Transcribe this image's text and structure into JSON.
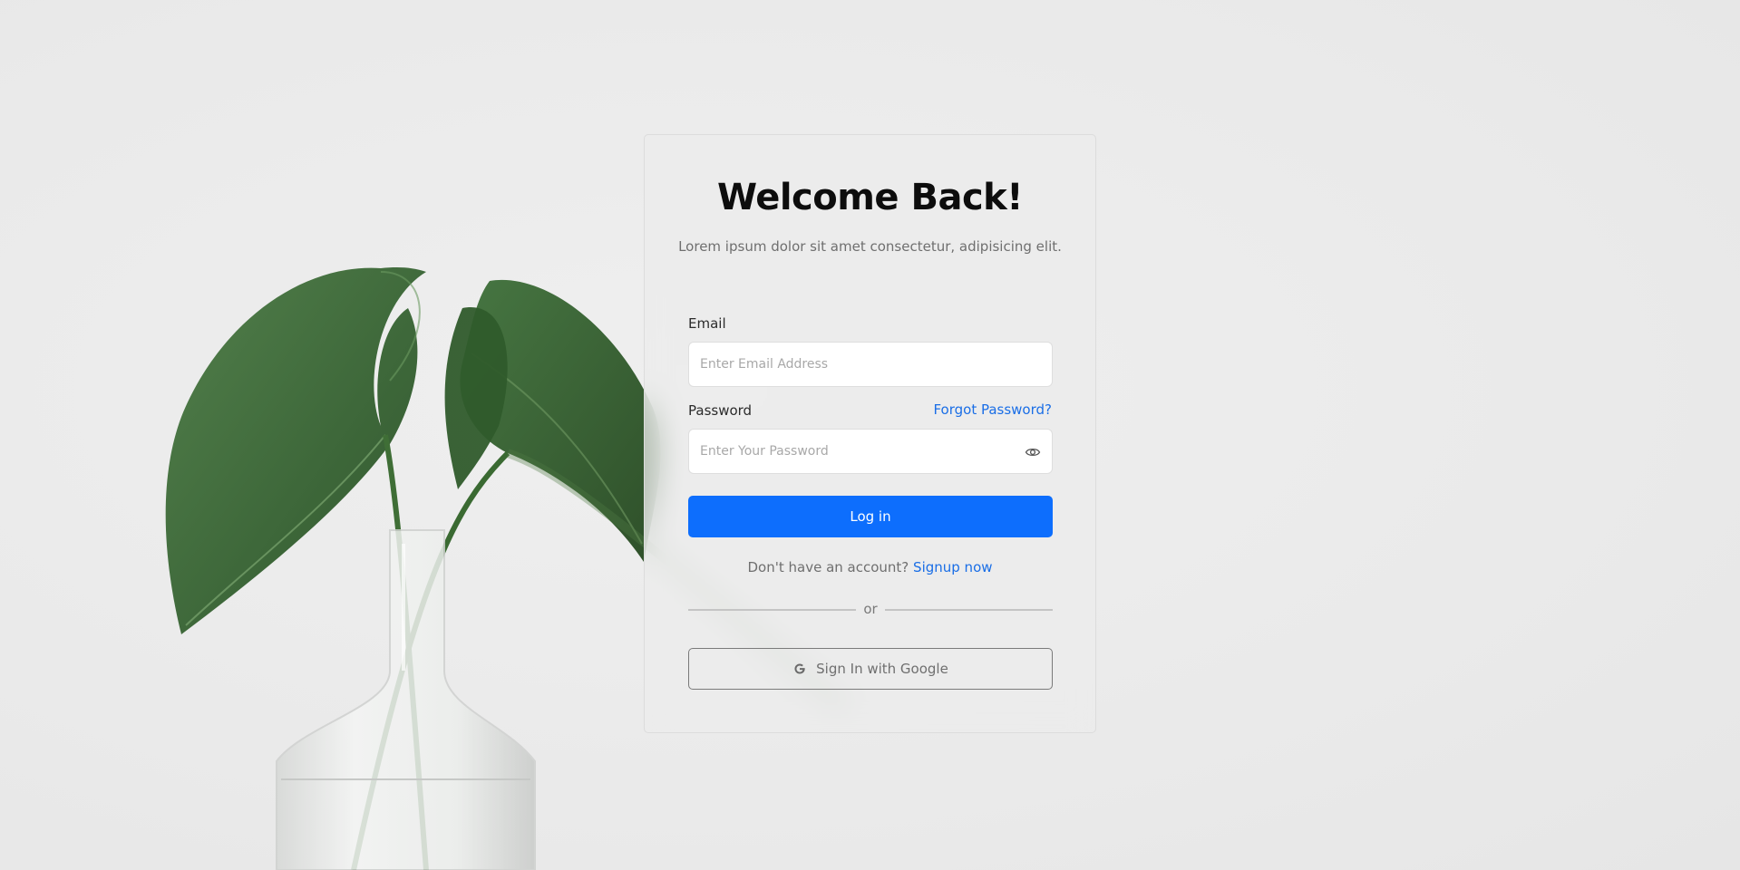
{
  "login": {
    "title": "Welcome Back!",
    "subtitle": "Lorem ipsum dolor sit amet consectetur, adipisicing elit.",
    "email_label": "Email",
    "email_placeholder": "Enter Email Address",
    "password_label": "Password",
    "forgot_link": "Forgot Password?",
    "password_placeholder": "Enter Your Password",
    "login_button": "Log in",
    "signup_prompt": "Don't have an account?",
    "signup_link": "Signup now",
    "divider_text": "or",
    "google_button": "Sign In with Google"
  },
  "colors": {
    "primary": "#0d6efd",
    "link": "#1a6ee6",
    "background": "#ebebeb",
    "leaf": "#3f6b3a"
  },
  "icons": {
    "password_toggle": "eye-icon",
    "google": "google-icon"
  }
}
